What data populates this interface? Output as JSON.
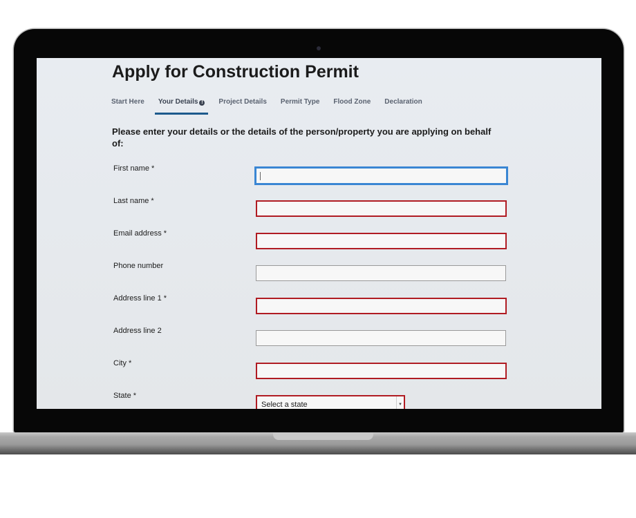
{
  "page": {
    "title": "Apply for Construction Permit",
    "tabs": [
      {
        "label": "Start Here",
        "active": false
      },
      {
        "label": "Your Details",
        "active": true,
        "icon": "info-icon"
      },
      {
        "label": "Project Details",
        "active": false
      },
      {
        "label": "Permit Type",
        "active": false
      },
      {
        "label": "Flood Zone",
        "active": false
      },
      {
        "label": "Declaration",
        "active": false
      }
    ],
    "lead": "Please enter your details or the details of the person/property you are applying on behalf of:",
    "fields": [
      {
        "label": "First name  *",
        "value": "",
        "state": "focused"
      },
      {
        "label": "Last name  *",
        "value": "",
        "state": "error"
      },
      {
        "label": "Email address  *",
        "value": "",
        "state": "error"
      },
      {
        "label": "Phone number",
        "value": "",
        "state": "normal"
      },
      {
        "label": "Address line 1  *",
        "value": "",
        "state": "error"
      },
      {
        "label": "Address line 2",
        "value": "",
        "state": "normal"
      },
      {
        "label": "City  *",
        "value": "",
        "state": "error"
      }
    ],
    "state_field": {
      "label": "State  *",
      "selected": "Select a state",
      "state": "error"
    }
  },
  "colors": {
    "focus": "#3a86d3",
    "error": "#b01b22",
    "active_tab": "#1d5a8c"
  }
}
